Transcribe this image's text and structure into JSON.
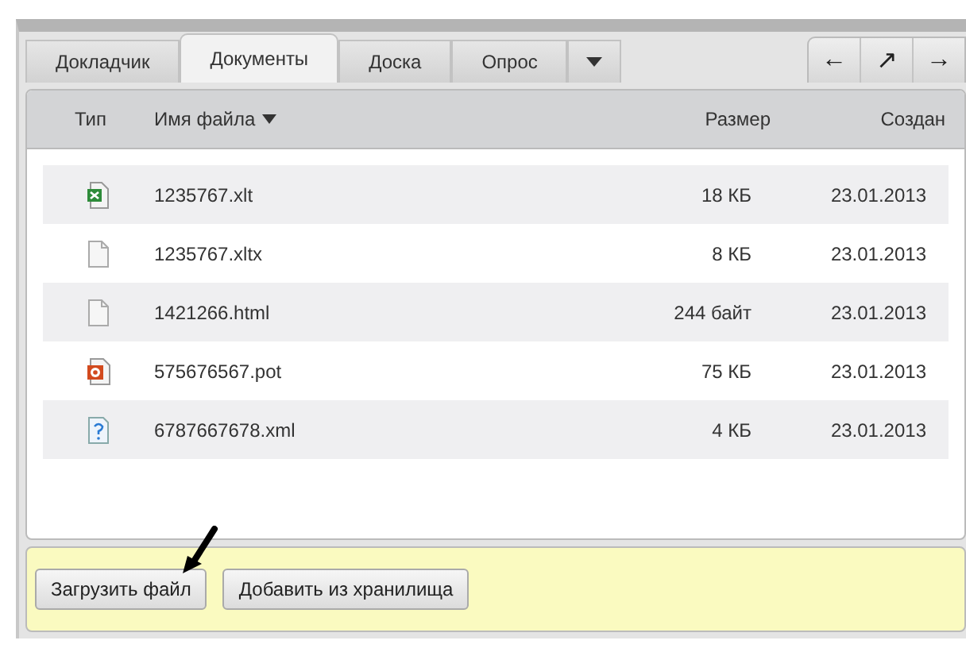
{
  "tabs": [
    {
      "label": "Докладчик",
      "selected": false
    },
    {
      "label": "Документы",
      "selected": true
    },
    {
      "label": "Доска",
      "selected": false
    },
    {
      "label": "Опрос",
      "selected": false
    }
  ],
  "nav_buttons": [
    "←",
    "↗",
    "→"
  ],
  "table": {
    "columns": [
      "Тип",
      "Имя файла",
      "Размер",
      "Создан"
    ],
    "rows": [
      {
        "kind": "excel",
        "name": "1235767.xlt",
        "size": "18 КБ",
        "created": "23.01.2013"
      },
      {
        "kind": "blank",
        "name": "1235767.xltx",
        "size": "8 КБ",
        "created": "23.01.2013"
      },
      {
        "kind": "blank",
        "name": "1421266.html",
        "size": "244 байт",
        "created": "23.01.2013"
      },
      {
        "kind": "powerpoint",
        "name": "575676567.pot",
        "size": "75 КБ",
        "created": "23.01.2013"
      },
      {
        "kind": "unknown",
        "name": "6787667678.xml",
        "size": "4 КБ",
        "created": "23.01.2013"
      }
    ]
  },
  "buttons": [
    "Загрузить файл",
    "Добавить из хранилища"
  ]
}
